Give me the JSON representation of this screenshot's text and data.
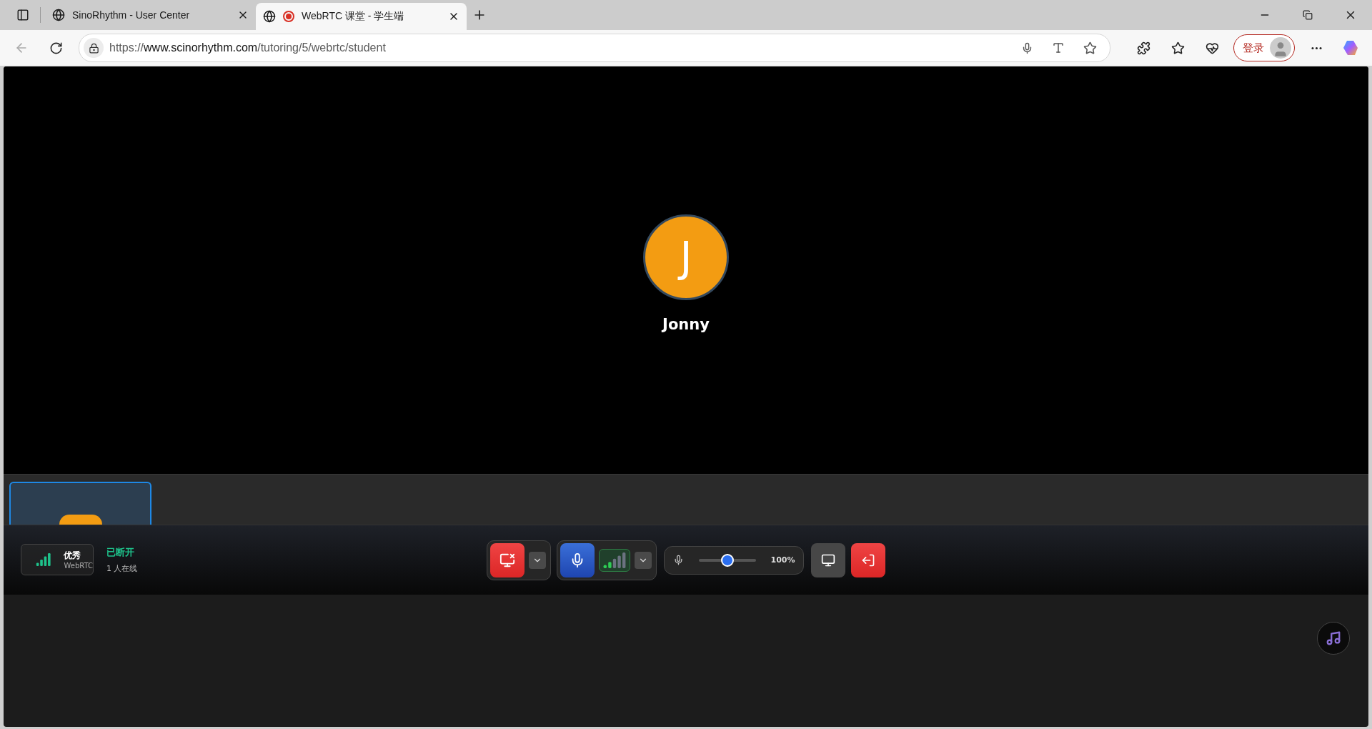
{
  "browser": {
    "tabs": [
      {
        "title": "SinoRhythm - User Center",
        "selected": false,
        "recording": false
      },
      {
        "title": "WebRTC 课堂 - 学生端",
        "selected": true,
        "recording": true
      }
    ],
    "url": {
      "prefix": "https://",
      "host": "www.scinorhythm.com",
      "path": "/tutoring/5/webrtc/student"
    },
    "login_label": "登录"
  },
  "stage": {
    "initial": "J",
    "name": "Jonny"
  },
  "thumbnails": [
    {
      "selected": true
    }
  ],
  "status": {
    "quality": "优秀",
    "protocol": "WebRTC",
    "connection": "已断开",
    "online": "1 人在线"
  },
  "controls": {
    "camera_off": true,
    "mic_on": true,
    "volume": {
      "level": 0.5,
      "reading": "100%"
    }
  }
}
